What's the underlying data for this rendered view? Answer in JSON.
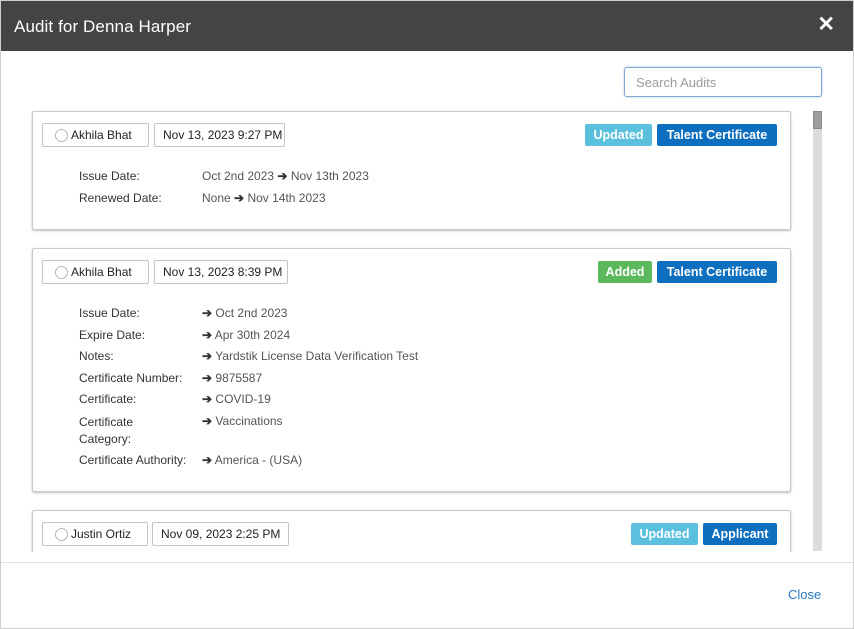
{
  "modal": {
    "title": "Audit for Denna Harper",
    "close_icon": "close-icon",
    "search_placeholder": "Search Audits",
    "close_label": "Close"
  },
  "colors": {
    "header_bg": "#444444",
    "updated_badge": "#5bc0de",
    "added_badge": "#5cb85c",
    "type_badge": "#0e6fbf",
    "link": "#2a78c4"
  },
  "audits": [
    {
      "user": "Akhila Bhat",
      "timestamp": "Nov 13, 2023 9:27 PM",
      "action": "Updated",
      "type": "Talent Certificate",
      "fields": [
        {
          "label": "Issue Date:",
          "from": "Oct 2nd 2023",
          "to": "Nov 13th 2023"
        },
        {
          "label": "Renewed Date:",
          "from": "None",
          "to": "Nov 14th 2023"
        }
      ]
    },
    {
      "user": "Akhila Bhat",
      "timestamp": "Nov 13, 2023 8:39 PM",
      "action": "Added",
      "type": "Talent Certificate",
      "fields": [
        {
          "label": "Issue Date:",
          "to": "Oct 2nd 2023"
        },
        {
          "label": "Expire Date:",
          "to": "Apr 30th 2024"
        },
        {
          "label": "Notes:",
          "to": "Yardstik License Data Verification Test"
        },
        {
          "label": "Certificate Number:",
          "to": "9875587"
        },
        {
          "label": "Certificate:",
          "to": "COVID-19"
        },
        {
          "label": "Certificate Category:",
          "to": "Vaccinations"
        },
        {
          "label": "Certificate Authority:",
          "to": "America - (USA)"
        }
      ]
    },
    {
      "user": "Justin Ortiz",
      "timestamp": "Nov 09, 2023 2:25 PM",
      "action": "Updated",
      "type": "Applicant",
      "fields": []
    }
  ],
  "arrow_glyph": "➔"
}
